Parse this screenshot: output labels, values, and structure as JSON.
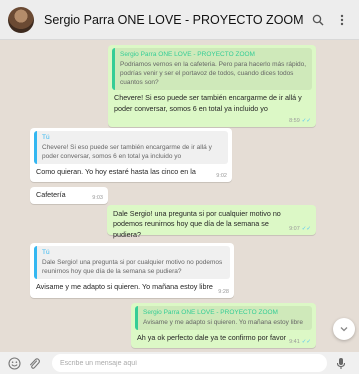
{
  "header": {
    "contact_name": "Sergio Parra ONE LOVE - PROYECTO ZOOM",
    "search_icon": "search-icon",
    "menu_icon": "menu-icon"
  },
  "messages": [
    {
      "direction": "out",
      "quote_author": "Sergio Parra ONE LOVE - PROYECTO ZOOM",
      "quote_text": "Podriamos vernos en la cafeteria. Pero para hacerlo más rápido, podrías venir y ser el portavoz de todos, cuando dices todos cuantos son?",
      "text": "Chevere! Si eso puede ser también encargarme de ir allá y poder conversar, somos 6 en total ya incluido yo",
      "time": "8:59",
      "status": "read"
    },
    {
      "direction": "in",
      "quote_author": "Tú",
      "quote_text": "Chevere! Si eso puede ser también encargarme de ir allá y poder conversar, somos 6 en total ya incluido yo",
      "text": "Como quieran. Yo hoy estaré hasta las cinco en la",
      "time": "9:02"
    },
    {
      "direction": "in",
      "text": "Cafetería",
      "time": "9:03"
    },
    {
      "direction": "out",
      "text": "Dale Sergio! una pregunta si por cualquier motivo no podemos reunirnos hoy que día de la semana se pudiera?",
      "time": "9:07",
      "status": "read"
    },
    {
      "direction": "in",
      "quote_author": "Tú",
      "quote_text": "Dale Sergio! una pregunta si por cualquier motivo no podemos reunirnos hoy que día de la semana se pudiera?",
      "text": "Avisame y me adapto si quieren. Yo mañana estoy libre",
      "time": "9:28"
    },
    {
      "direction": "out",
      "quote_author": "Sergio Parra ONE LOVE - PROYECTO ZOOM",
      "quote_text": "Avisame y me adapto si quieren. Yo mañana estoy libre",
      "text": "Ah ya ok perfecto dale ya te confirmo por favor",
      "time": "9:41",
      "status": "read"
    }
  ],
  "composer": {
    "placeholder": "Escribe un mensaje aquí",
    "emoji_icon": "emoji-icon",
    "attach_icon": "paperclip-icon",
    "mic_icon": "microphone-icon"
  },
  "colors": {
    "header_bg": "#ededed",
    "chat_bg": "#e5ddd5",
    "outgoing_bubble": "#dcf8c6",
    "incoming_bubble": "#ffffff",
    "quote_green": "#35cd96",
    "quote_blue": "#34b7f1",
    "read_tick": "#4fc3f7"
  }
}
